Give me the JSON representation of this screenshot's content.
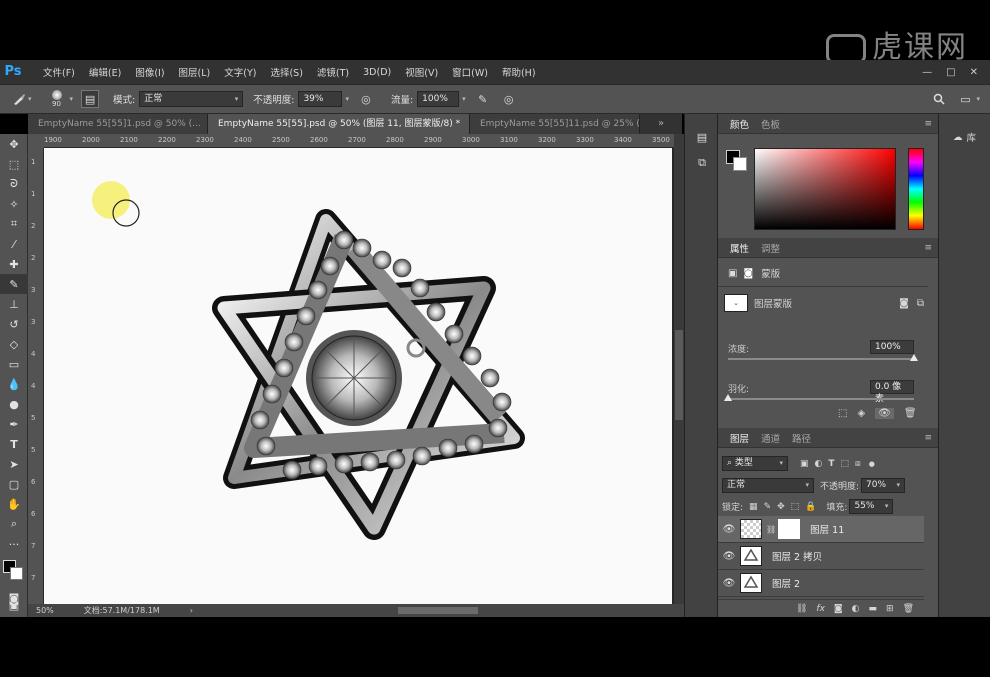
{
  "watermark": {
    "text": "虎课网"
  },
  "menubar": {
    "app_logo": "Ps",
    "items": [
      "文件(F)",
      "编辑(E)",
      "图像(I)",
      "图层(L)",
      "文字(Y)",
      "选择(S)",
      "滤镜(T)",
      "3D(D)",
      "视图(V)",
      "窗口(W)",
      "帮助(H)"
    ],
    "window_controls": [
      "—",
      "□",
      "✕"
    ]
  },
  "options": {
    "brush_size": "90",
    "mode_label": "模式:",
    "mode_value": "正常",
    "opacity_label": "不透明度:",
    "opacity_value": "39%",
    "flow_label": "流量:",
    "flow_value": "100%"
  },
  "tabs": [
    {
      "label": "EmptyName 55[55]1.psd @ 50% (...",
      "close": "✕",
      "active": false
    },
    {
      "label": "EmptyName 55[55].psd @ 50% (图层 11, 图层蒙版/8) *",
      "close": "✕",
      "active": true
    },
    {
      "label": "EmptyName 55[55]11.psd @ 25% (...",
      "close": "✕",
      "active": false
    }
  ],
  "ruler": {
    "h_ticks": [
      "1900",
      "2000",
      "2100",
      "2200",
      "2300",
      "2400",
      "2500",
      "2600",
      "2700",
      "2800",
      "2900",
      "3000",
      "3100",
      "3200",
      "3300",
      "3400",
      "3500"
    ],
    "v_ticks": [
      "1",
      "1",
      "2",
      "2",
      "3",
      "3",
      "4",
      "4",
      "5",
      "5",
      "6",
      "6",
      "7",
      "7"
    ]
  },
  "statusbar": {
    "zoom": "50%",
    "doc_info": "文档:57.1M/178.1M",
    "arrow": "›"
  },
  "color_panel": {
    "tabs": [
      "颜色",
      "色板"
    ]
  },
  "properties_panel": {
    "tabs": [
      "属性",
      "调整"
    ],
    "mask_type": "蒙版",
    "layer_mask_label": "图层蒙版",
    "density_label": "浓度:",
    "density_value": "100%",
    "density_level": 1.0,
    "feather_label": "羽化:",
    "feather_value": "0.0 像素",
    "feather_level": 0.0
  },
  "layers_panel": {
    "tabs": [
      "图层",
      "通道",
      "路径"
    ],
    "filter_value": "类型",
    "blend_mode": "正常",
    "opacity_label": "不透明度:",
    "opacity_value": "70%",
    "lock_label": "锁定:",
    "fill_label": "填充:",
    "fill_value": "55%",
    "layers": [
      {
        "name": "图层 11",
        "selected": true
      },
      {
        "name": "图层 2 拷贝",
        "selected": false
      },
      {
        "name": "图层 2",
        "selected": false
      }
    ],
    "footer_icons": [
      "link-icon",
      "fx-icon",
      "mask-icon",
      "adjustment-icon",
      "folder-icon",
      "new-layer-icon",
      "trash-icon"
    ]
  },
  "library": {
    "label": "库"
  }
}
